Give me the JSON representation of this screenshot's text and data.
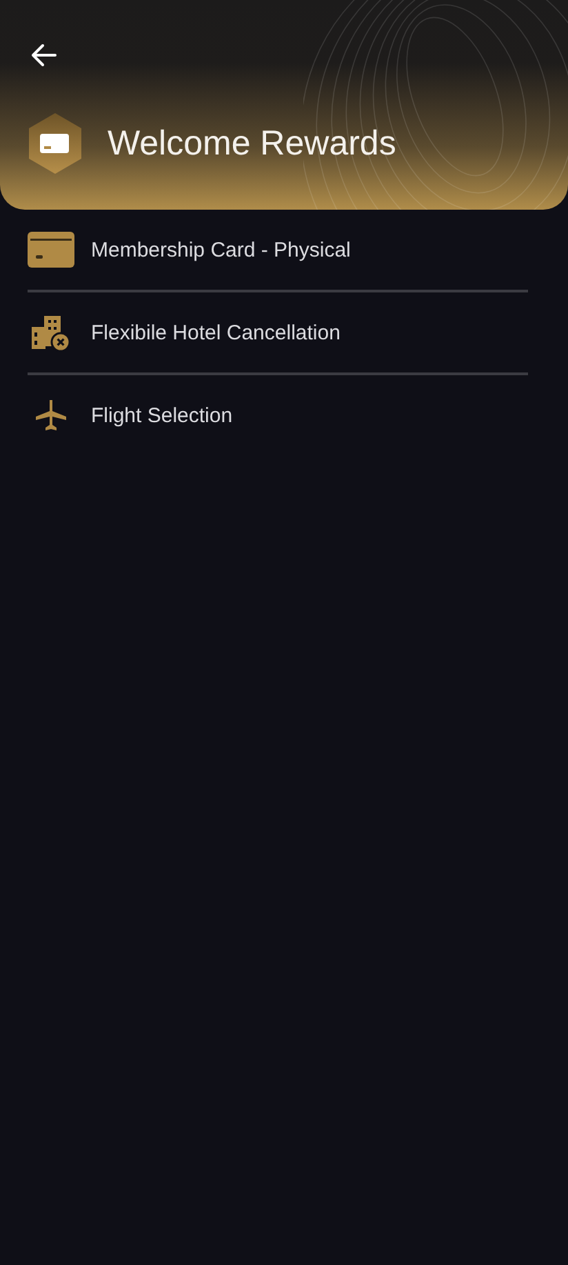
{
  "header": {
    "title": "Welcome Rewards"
  },
  "benefits": [
    {
      "kind": "card",
      "label": "Membership Card - Physical"
    },
    {
      "kind": "hotel",
      "label": "Flexibile Hotel Cancellation"
    },
    {
      "kind": "flight",
      "label": "Flight Selection"
    }
  ]
}
